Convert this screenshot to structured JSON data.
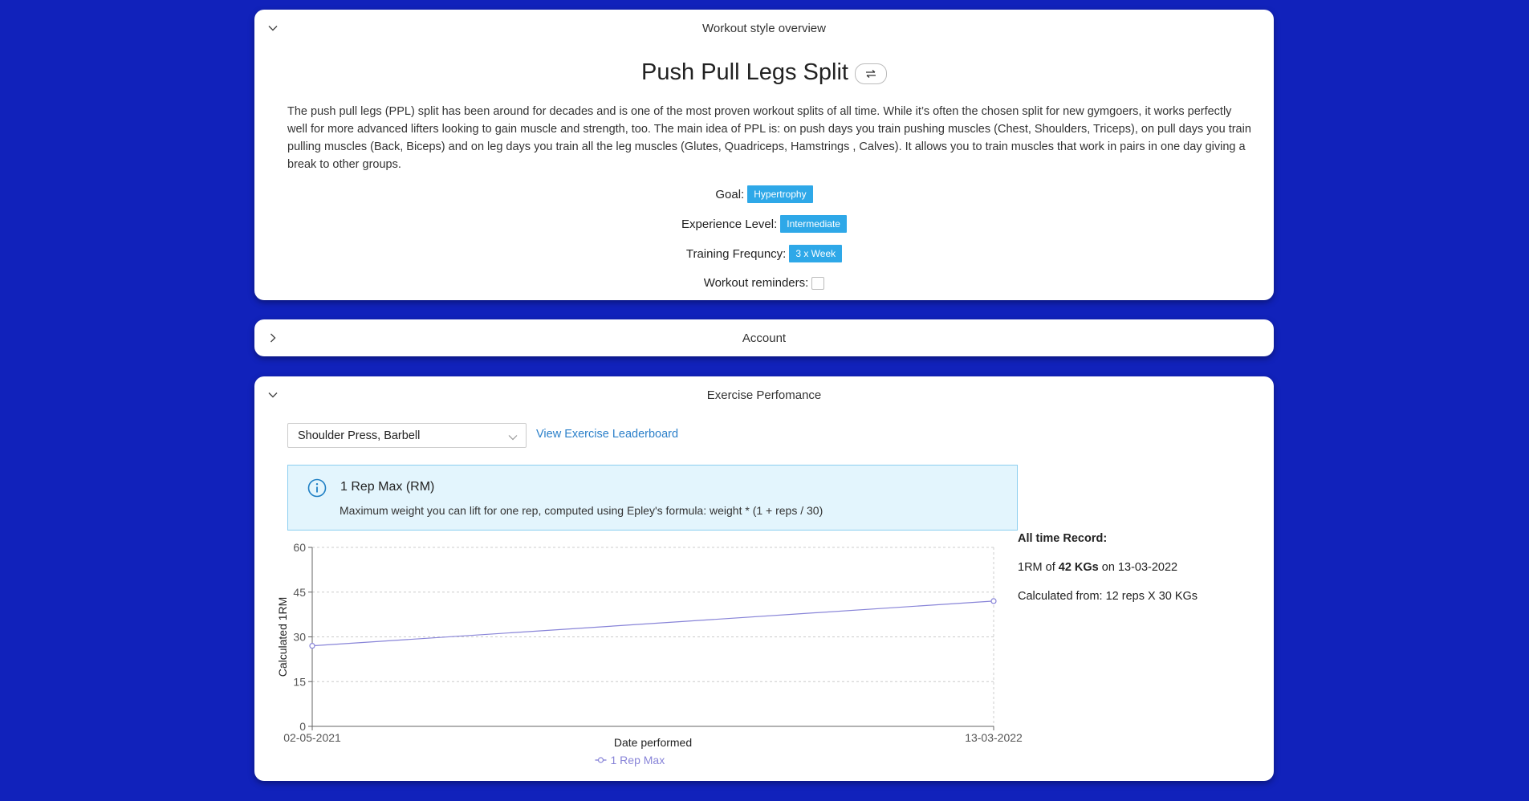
{
  "overview": {
    "header": "Workout style overview",
    "plan_title": "Push Pull Legs Split",
    "description": "The push pull legs (PPL) split has been around for decades and is one of the most proven workout splits of all time. While it’s often the chosen split for new gymgoers, it works perfectly well for more advanced lifters looking to gain muscle and strength, too. The main idea of PPL is: on push days you train pushing muscles (Chest, Shoulders, Triceps), on pull days you train pulling muscles (Back, Biceps) and on leg days you train all the leg muscles (Glutes, Quadriceps, Hamstrings , Calves). It allows you to train muscles that work in pairs in one day giving a break to other groups.",
    "goal_label": "Goal:",
    "goal_value": "Hypertrophy",
    "experience_label": "Experience Level:",
    "experience_value": "Intermediate",
    "frequency_label": "Training Frequncy:",
    "frequency_value": "3 x Week",
    "reminders_label": "Workout reminders:",
    "reminders_checked": false
  },
  "account": {
    "header": "Account"
  },
  "performance": {
    "header": "Exercise Perfomance",
    "exercise_selected": "Shoulder Press, Barbell",
    "leaderboard_link": "View Exercise Leaderboard",
    "info_title": "1 Rep Max (RM)",
    "info_text": "Maximum weight you can lift for one rep, computed using Epley's formula: weight * (1 + reps / 30)",
    "record_title": "All time Record:",
    "record_prefix": "1RM of ",
    "record_value": "42 KGs",
    "record_suffix": " on 13-03-2022",
    "record_calc": "Calculated from: 12 reps X 30 KGs"
  },
  "colors": {
    "background": "#1122bb",
    "tag": "#2ea8e8",
    "link": "#2a7fc9",
    "series": "#8884d8"
  },
  "chart_data": {
    "type": "line",
    "x": [
      "02-05-2021",
      "13-03-2022"
    ],
    "series": [
      {
        "name": "1 Rep Max",
        "values": [
          27,
          42
        ]
      }
    ],
    "xlabel": "Date performed",
    "ylabel": "Calculated 1RM",
    "ylim": [
      0,
      60
    ],
    "yticks": [
      0,
      15,
      30,
      45,
      60
    ],
    "grid": true,
    "legend": "bottom-center"
  }
}
